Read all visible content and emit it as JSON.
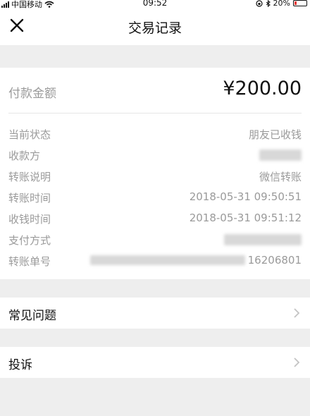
{
  "status_bar": {
    "carrier": "中国移动",
    "time": "09:52",
    "battery": "20%"
  },
  "nav": {
    "title": "交易记录"
  },
  "detail": {
    "amount_label": "付款金额",
    "amount_value": "¥200.00",
    "rows": [
      {
        "label": "当前状态",
        "value": "朋友已收钱"
      },
      {
        "label": "收款方",
        "value": ""
      },
      {
        "label": "转账说明",
        "value": "微信转账"
      },
      {
        "label": "转账时间",
        "value": "2018-05-31 09:50:51"
      },
      {
        "label": "收钱时间",
        "value": "2018-05-31 09:51:12"
      },
      {
        "label": "支付方式",
        "value": ""
      },
      {
        "label": "转账单号",
        "value": "16206801"
      }
    ]
  },
  "menu": [
    {
      "label": "常见问题"
    },
    {
      "label": "投诉"
    }
  ],
  "icons": {
    "close": "close-icon",
    "chevron": "chevron-right-icon",
    "wifi": "wifi-icon",
    "bluetooth": "bluetooth-icon",
    "lock": "rotation-lock-icon"
  }
}
